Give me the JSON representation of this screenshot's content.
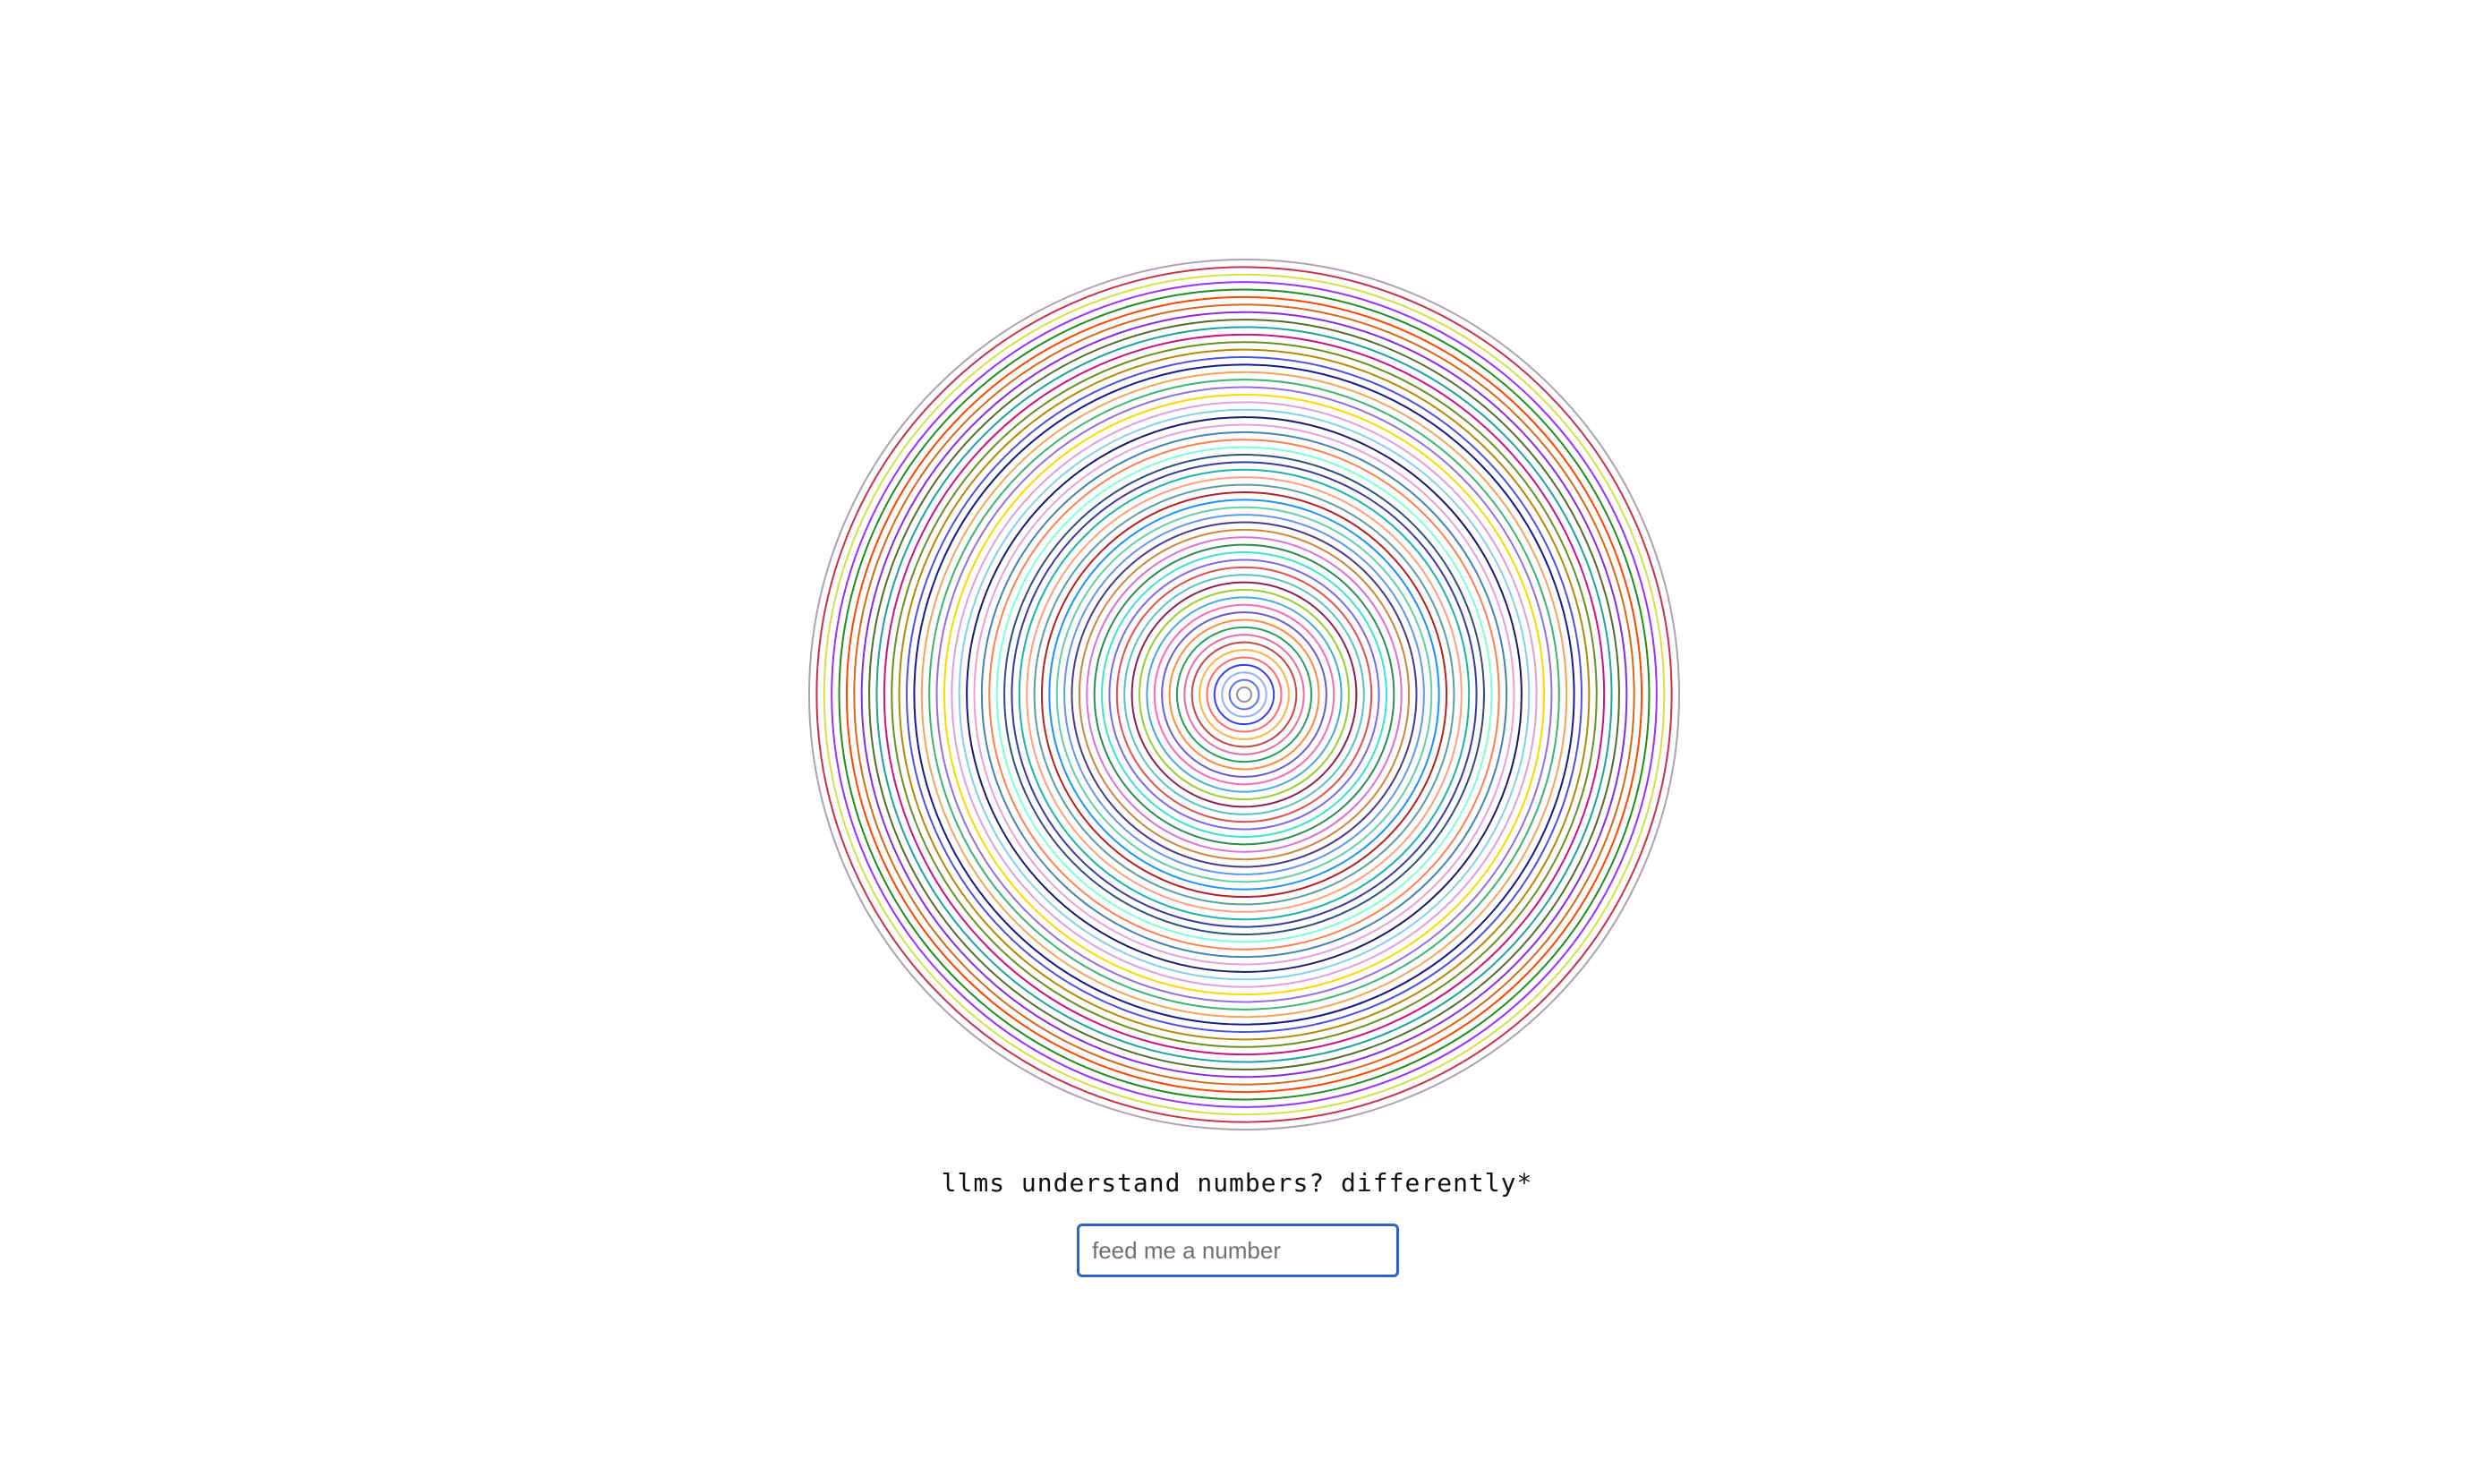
{
  "caption": "llms understand numbers? differently*",
  "input": {
    "placeholder": "feed me a number",
    "value": ""
  },
  "rings": {
    "count": 58,
    "colors": [
      "#8e8e9a",
      "#5b6bff",
      "#8fb3ff",
      "#3b3bff",
      "#ff6b6b",
      "#ffb347",
      "#c04a4a",
      "#e070a0",
      "#2a9d5c",
      "#ff8c42",
      "#6a5acd",
      "#ff69b4",
      "#4aa8d8",
      "#9acd32",
      "#8b2252",
      "#5bc0be",
      "#e05050",
      "#7b68ee",
      "#40e0d0",
      "#2e8b57",
      "#da70d6",
      "#cd853f",
      "#483d8b",
      "#6495ed",
      "#66cdaa",
      "#1e90ff",
      "#b22222",
      "#5f9ea0",
      "#ffa07a",
      "#20b2aa",
      "#3a3aa0",
      "#2f4f7f",
      "#7fffd4",
      "#ff7f50",
      "#4682b4",
      "#e8a0d8",
      "#191970",
      "#87ceeb",
      "#dda0dd",
      "#ffd700",
      "#9370db",
      "#3cb371",
      "#f4a460",
      "#1a1a8c",
      "#5050e0",
      "#b8860b",
      "#6b8e23",
      "#c71585",
      "#20a0a0",
      "#556b2f",
      "#8a2be2",
      "#d2691e",
      "#ff4500",
      "#228b22",
      "#9b30ff",
      "#d4e04a",
      "#c8324a",
      "#b0a0b0"
    ]
  }
}
